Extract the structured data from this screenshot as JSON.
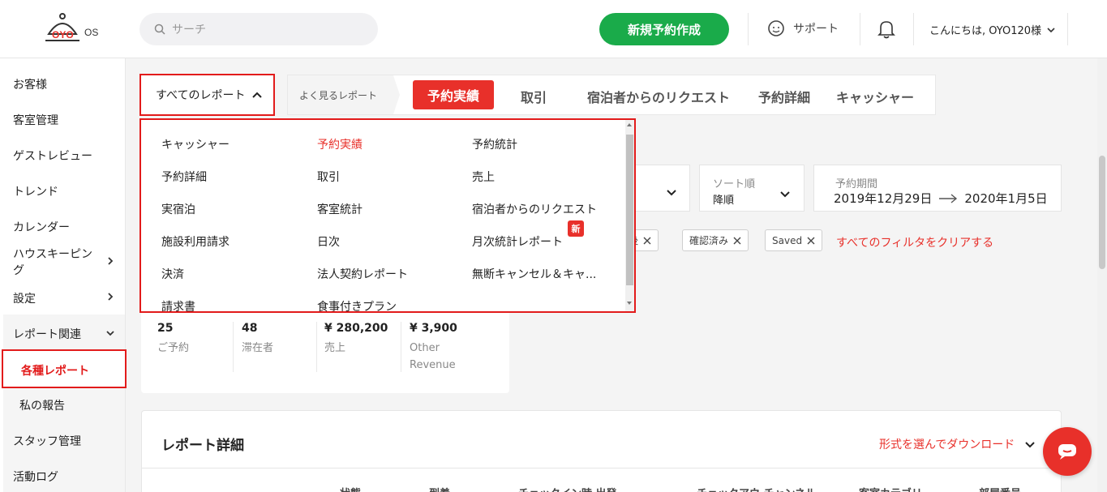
{
  "header": {
    "logo_text": "OYO",
    "logo_suffix": "OS",
    "search_placeholder": "サーチ",
    "new_booking": "新規予約作成",
    "support": "サポート",
    "greeting": "こんにちは, OYO120様"
  },
  "sidebar": {
    "items": [
      {
        "label": "お客様"
      },
      {
        "label": "客室管理"
      },
      {
        "label": "ゲストレビュー"
      },
      {
        "label": "トレンド"
      },
      {
        "label": "カレンダー"
      },
      {
        "label": "ハウスキーピン"
      },
      {
        "label": "グ"
      },
      {
        "label": "設定"
      },
      {
        "label": "レポート関連"
      },
      {
        "label": "各種レポート"
      },
      {
        "label": "私の報告"
      },
      {
        "label": "スタッフ管理"
      },
      {
        "label": "活動ログ"
      }
    ]
  },
  "reports": {
    "all_reports": "すべてのレポート",
    "frequent": "よく見るレポート",
    "tabs": [
      "予約実績",
      "取引",
      "宿泊者からのリクエスト",
      "予約詳細",
      "キャッシャー"
    ]
  },
  "dropdown": {
    "items": [
      "キャッシャー",
      "予約実績",
      "予約統計",
      "予約詳細",
      "取引",
      "売上",
      "実宿泊",
      "客室統計",
      "宿泊者からのリクエスト",
      "施設利用請求",
      "日次",
      "月次統計レポート",
      "決済",
      "法人契約レポート",
      "無断キャンセル＆キャ...",
      "請求書",
      "食事付きプラン"
    ],
    "new_badge": "新"
  },
  "filters": {
    "sort_label": "ソート順",
    "sort_value": "降順",
    "period_label": "予約期間",
    "period_from": "2019年12月29日",
    "period_to": "2020年1月5日",
    "chips": [
      "後",
      "確認済み",
      "Saved"
    ],
    "clear": "すべてのフィルタをクリアする"
  },
  "summary": {
    "stats": [
      {
        "num": "25",
        "cap": "ご予約"
      },
      {
        "num": "48",
        "cap": "滞在者"
      },
      {
        "num": "¥ 280,200",
        "cap": "売上"
      },
      {
        "num": "¥ 3,900",
        "cap": "Other Revenue"
      }
    ]
  },
  "details": {
    "title": "レポート詳細",
    "download": "形式を選んでダウンロード",
    "headers": [
      "状態",
      "到着",
      "チェックイン時 出発",
      "チェックアウ チャンネル",
      "客室カテゴリ",
      "部屋番号"
    ]
  },
  "colors": {
    "accent": "#e8302a",
    "green": "#1aab4a"
  }
}
